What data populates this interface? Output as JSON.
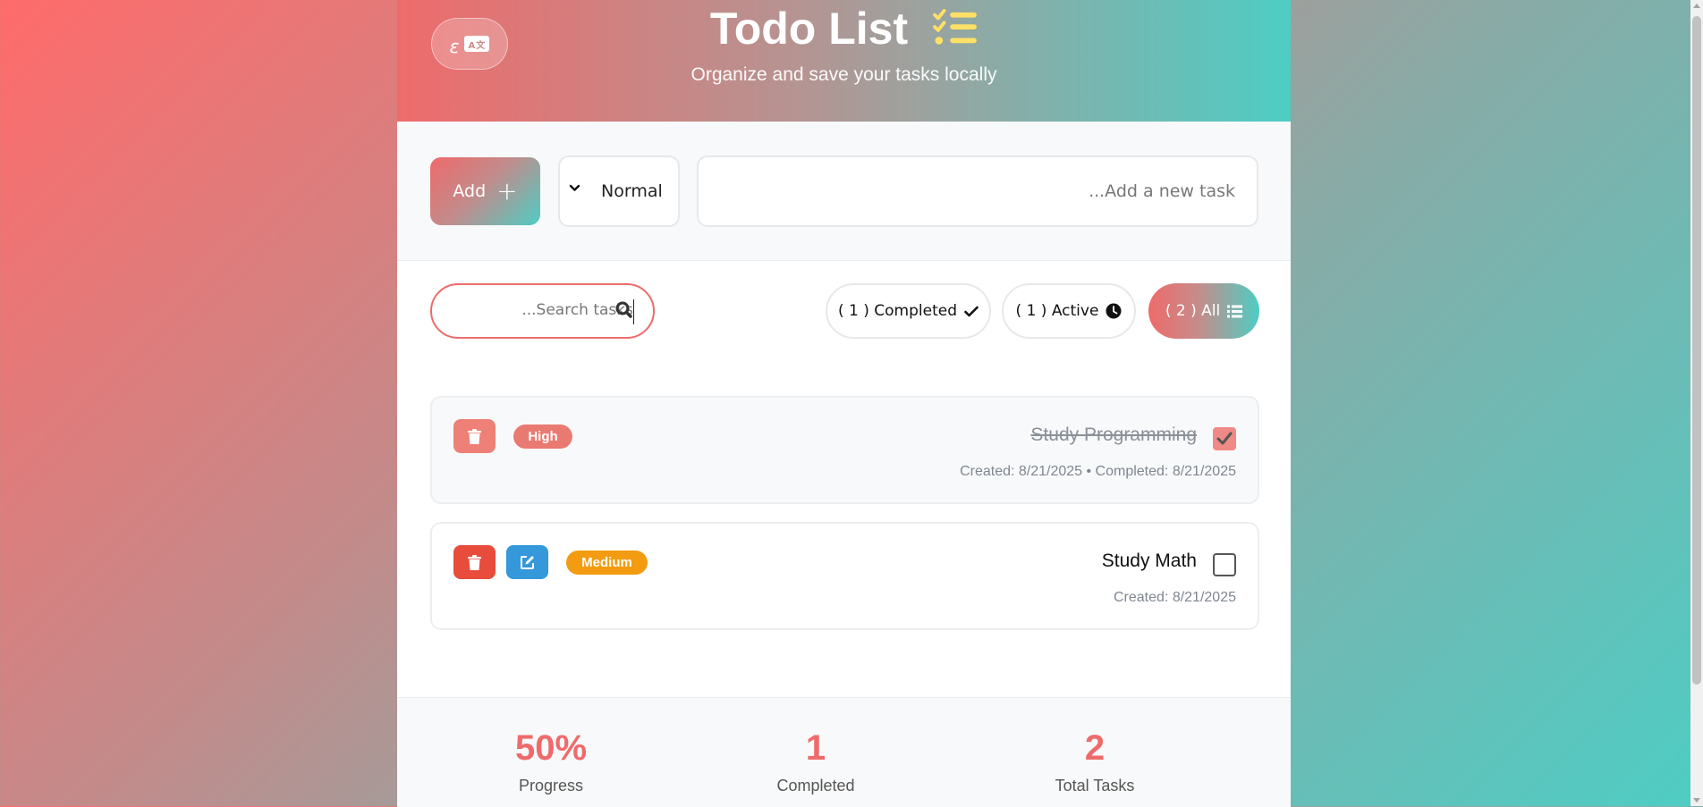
{
  "header": {
    "title": "Todo List",
    "subtitle": "Organize and save your tasks locally",
    "lang_glyph": "ε",
    "lang_icon_text": "A文"
  },
  "add": {
    "button_label": "Add",
    "priority_value": "Normal",
    "task_placeholder": "...Add a new task"
  },
  "search": {
    "placeholder": "...Search tasks"
  },
  "filters": [
    {
      "label": "( 1 ) Completed",
      "icon": "check-icon",
      "active": false
    },
    {
      "label": "( 1 ) Active",
      "icon": "clock-icon",
      "active": false
    },
    {
      "label": "( 2 ) All",
      "icon": "list-icon",
      "active": true
    }
  ],
  "tasks": [
    {
      "text": "Study Programming",
      "priority": "High",
      "completed": true,
      "meta": "Created: 8/21/2025 • Completed: 8/21/2025"
    },
    {
      "text": "Study Math",
      "priority": "Medium",
      "completed": false,
      "meta": "Created: 8/21/2025"
    }
  ],
  "stats": [
    {
      "value": "50%",
      "label": "Progress"
    },
    {
      "value": "1",
      "label": "Completed"
    },
    {
      "value": "2",
      "label": "Total Tasks"
    }
  ],
  "colors": {
    "accent_red": "#ef6b6b",
    "accent_teal": "#4ecdc4",
    "delete": "#e74c3c",
    "edit": "#3498db",
    "medium": "#f39c12",
    "list_icon": "#ffe066"
  }
}
